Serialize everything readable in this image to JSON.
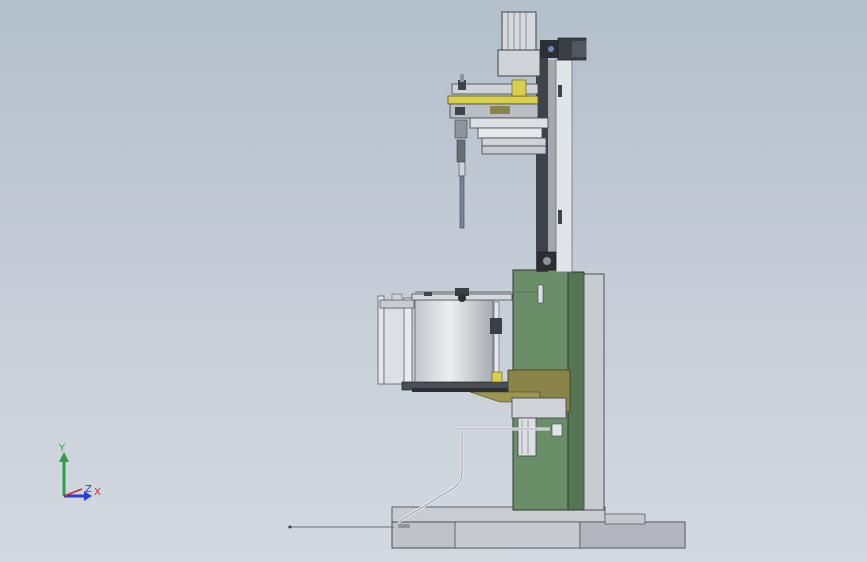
{
  "viewport": {
    "background_top": "#b4bfcc",
    "background_bottom": "#d3d9df"
  },
  "colors": {
    "frame_green": "#6a8f68",
    "frame_green_dark": "#557555",
    "olive_accent": "#8a8448",
    "yellow_accent": "#d8cf4a",
    "steel_light": "#dcdfe3",
    "steel_mid": "#b9bec5",
    "steel_dark": "#3e434a",
    "base_plate": "#bfc3c8"
  },
  "triad": {
    "y_label": "Y",
    "z_label": "Z",
    "x_label": "X",
    "y_color": "#2ea043",
    "x_color": "#d42a2a",
    "z_color": "#2a3fd4"
  },
  "scene": {
    "description_icon": "machine-assembly-icon"
  }
}
